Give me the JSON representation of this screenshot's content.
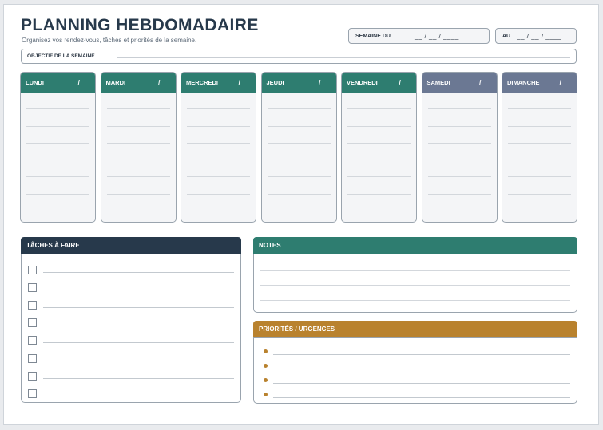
{
  "header": {
    "title": "PLANNING HEBDOMADAIRE",
    "subtitle": "Organisez vos rendez-vous, tâches et priorités de la semaine."
  },
  "week": {
    "from_label": "SEMAINE DU",
    "from_value": "__ / __ / ____",
    "to_label": "AU",
    "to_value": "__ / __ / ____"
  },
  "objective": {
    "label": "OBJECTIF DE LA SEMAINE"
  },
  "days": [
    {
      "name": "LUNDI",
      "date": "__ / __",
      "color": "#2e7d70"
    },
    {
      "name": "MARDI",
      "date": "__ / __",
      "color": "#2e7d70"
    },
    {
      "name": "MERCREDI",
      "date": "__ / __",
      "color": "#2e7d70"
    },
    {
      "name": "JEUDI",
      "date": "__ / __",
      "color": "#2e7d70"
    },
    {
      "name": "VENDREDI",
      "date": "__ / __",
      "color": "#2e7d70"
    },
    {
      "name": "SAMEDI",
      "date": "__ / __",
      "color": "#6b7893"
    },
    {
      "name": "DIMANCHE",
      "date": "__ / __",
      "color": "#6b7893"
    }
  ],
  "todo": {
    "title": "TÂCHES À FAIRE",
    "color": "#27394b"
  },
  "notes": {
    "title": "NOTES",
    "color": "#2e7d70"
  },
  "priorities": {
    "title": "PRIORITÉS / URGENCES",
    "color": "#b9822e"
  }
}
